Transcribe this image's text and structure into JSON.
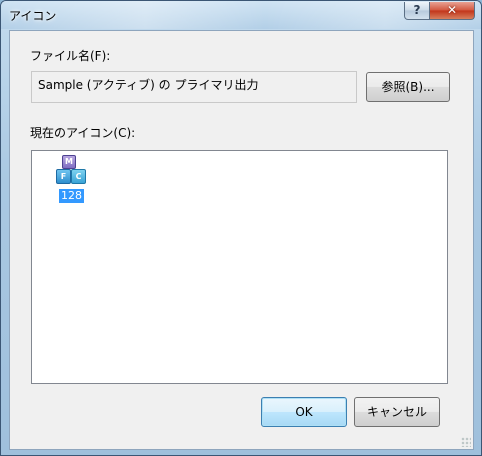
{
  "window": {
    "title": "アイコン",
    "help_glyph": "?",
    "close_glyph": "✕"
  },
  "file": {
    "label": "ファイル名(F):",
    "value": "Sample (アクティブ) の プライマリ出力",
    "browse_label": "参照(B)..."
  },
  "icons": {
    "label": "現在のアイコン(C):",
    "items": [
      {
        "name": "128",
        "icon": "app-icon-cubes",
        "selected": true
      }
    ]
  },
  "buttons": {
    "ok": "OK",
    "cancel": "キャンセル"
  },
  "colors": {
    "selection": "#3399ff",
    "close_button": "#c23319",
    "default_button_border": "#3c7fb1"
  }
}
